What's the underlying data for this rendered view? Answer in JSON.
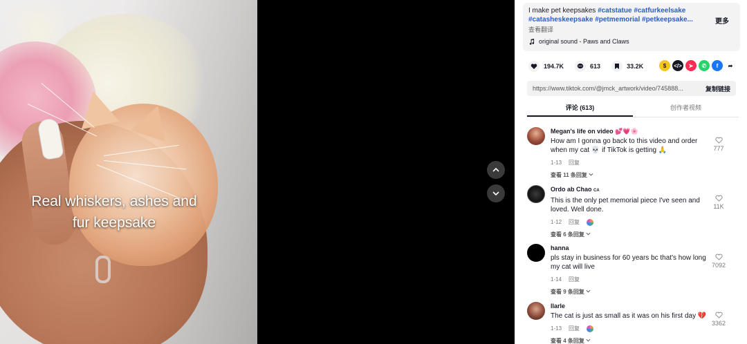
{
  "video": {
    "caption_line1": "Real whiskers, ashes and",
    "caption_line2": "fur keepsake"
  },
  "nav": {
    "up_icon": "chevron-up-icon",
    "down_icon": "chevron-down-icon"
  },
  "description": {
    "text_prefix": "I make pet keepsakes ",
    "tags": [
      "#catstatue",
      "#catfurkeelsake",
      "#catasheskeepsake",
      "#petmemorial",
      "#petkeepsake..."
    ],
    "more_label": "更多",
    "translate_label": "查看翻译",
    "sound_label": "original sound - Paws and Claws"
  },
  "actions": {
    "likes": "194.7K",
    "comments": "613",
    "saves": "33.2K"
  },
  "share_colors": {
    "embed": "#161823",
    "friends": "#fe2c55",
    "whatsapp": "#25d366",
    "facebook": "#1877f2",
    "yellow": "#f5c518"
  },
  "link": {
    "url": "https://www.tiktok.com/@jmck_artwork/video/745888...",
    "copy_label": "复制链接"
  },
  "tabs": [
    {
      "label": "评论 (613)"
    },
    {
      "label": "创作者视频"
    }
  ],
  "comments": [
    {
      "name": "Megan's life on video 💕💗🌸",
      "text": "How am I gonna go back to this video and order when my cat 💀  if TikTok is getting 🙏",
      "date": "1-13",
      "reply_label": "回复",
      "replies": "查看 11 条回复",
      "likes": "777"
    },
    {
      "name": "Ordo ab Chao",
      "badge": "CA",
      "text": "This is the only pet memorial piece I've seen and loved. Well done.",
      "date": "1-12",
      "reply_label": "回复",
      "replies": "查看 6 条回复",
      "likes": "11K"
    },
    {
      "name": "hanna",
      "text": "pls stay in business for 60 years bc that's how long my cat will live",
      "date": "1-14",
      "reply_label": "回复",
      "replies": "查看 9 条回复",
      "likes": "7092"
    },
    {
      "name": "llarle",
      "text": "The cat is just as small as it was on his first day 💔",
      "date": "1-13",
      "reply_label": "回复",
      "replies": "查看 4 条回复",
      "likes": "3362"
    }
  ]
}
